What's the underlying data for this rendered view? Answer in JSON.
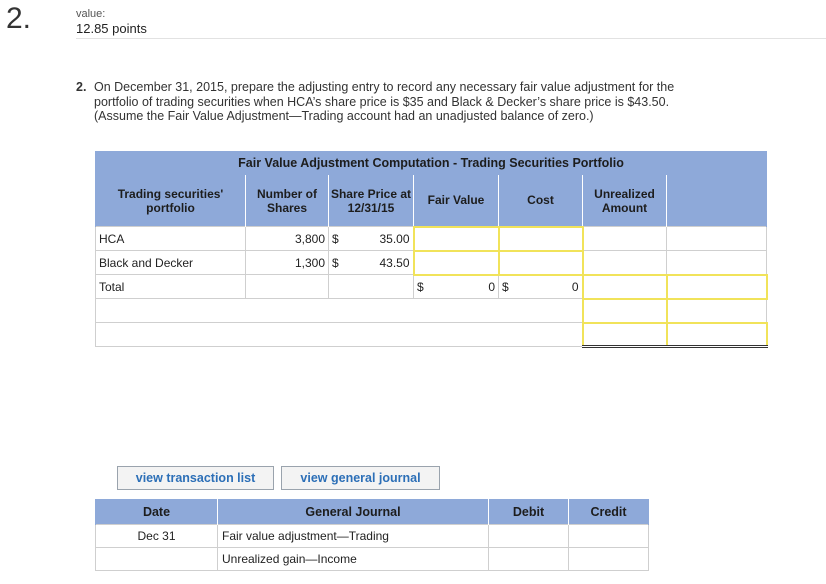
{
  "question": {
    "number": "2.",
    "value_label": "value:",
    "points": "12.85 points",
    "part_number": "2.",
    "prompt": "On December 31, 2015, prepare the adjusting entry to record any necessary fair value adjustment for the portfolio of trading securities when HCA’s share price is $35 and Black & Decker’s share price is $43.50. (Assume the Fair Value Adjustment—Trading account had an unadjusted balance of zero.)"
  },
  "fv_table": {
    "title": "Fair Value Adjustment Computation - Trading Securities Portfolio",
    "headers": {
      "portfolio": "Trading securities' portfolio",
      "shares": "Number of Shares",
      "price": "Share Price at 12/31/15",
      "fair_value": "Fair Value",
      "cost": "Cost",
      "unrealized": "Unrealized Amount"
    },
    "rows": [
      {
        "name": "HCA",
        "shares": "3,800",
        "currency": "$",
        "price": "35.00"
      },
      {
        "name": "Black and Decker",
        "shares": "1,300",
        "currency": "$",
        "price": "43.50"
      }
    ],
    "total": {
      "label": "Total",
      "fv_currency": "$",
      "fv_value": "0",
      "cost_currency": "$",
      "cost_value": "0"
    }
  },
  "buttons": {
    "view_transactions": "view transaction list",
    "view_journal": "view general journal"
  },
  "journal": {
    "headers": {
      "date": "Date",
      "account": "General Journal",
      "debit": "Debit",
      "credit": "Credit"
    },
    "entries": [
      {
        "date": "Dec 31",
        "account": "Fair value adjustment—Trading"
      },
      {
        "date": "",
        "account": "Unrealized gain—Income"
      }
    ]
  }
}
